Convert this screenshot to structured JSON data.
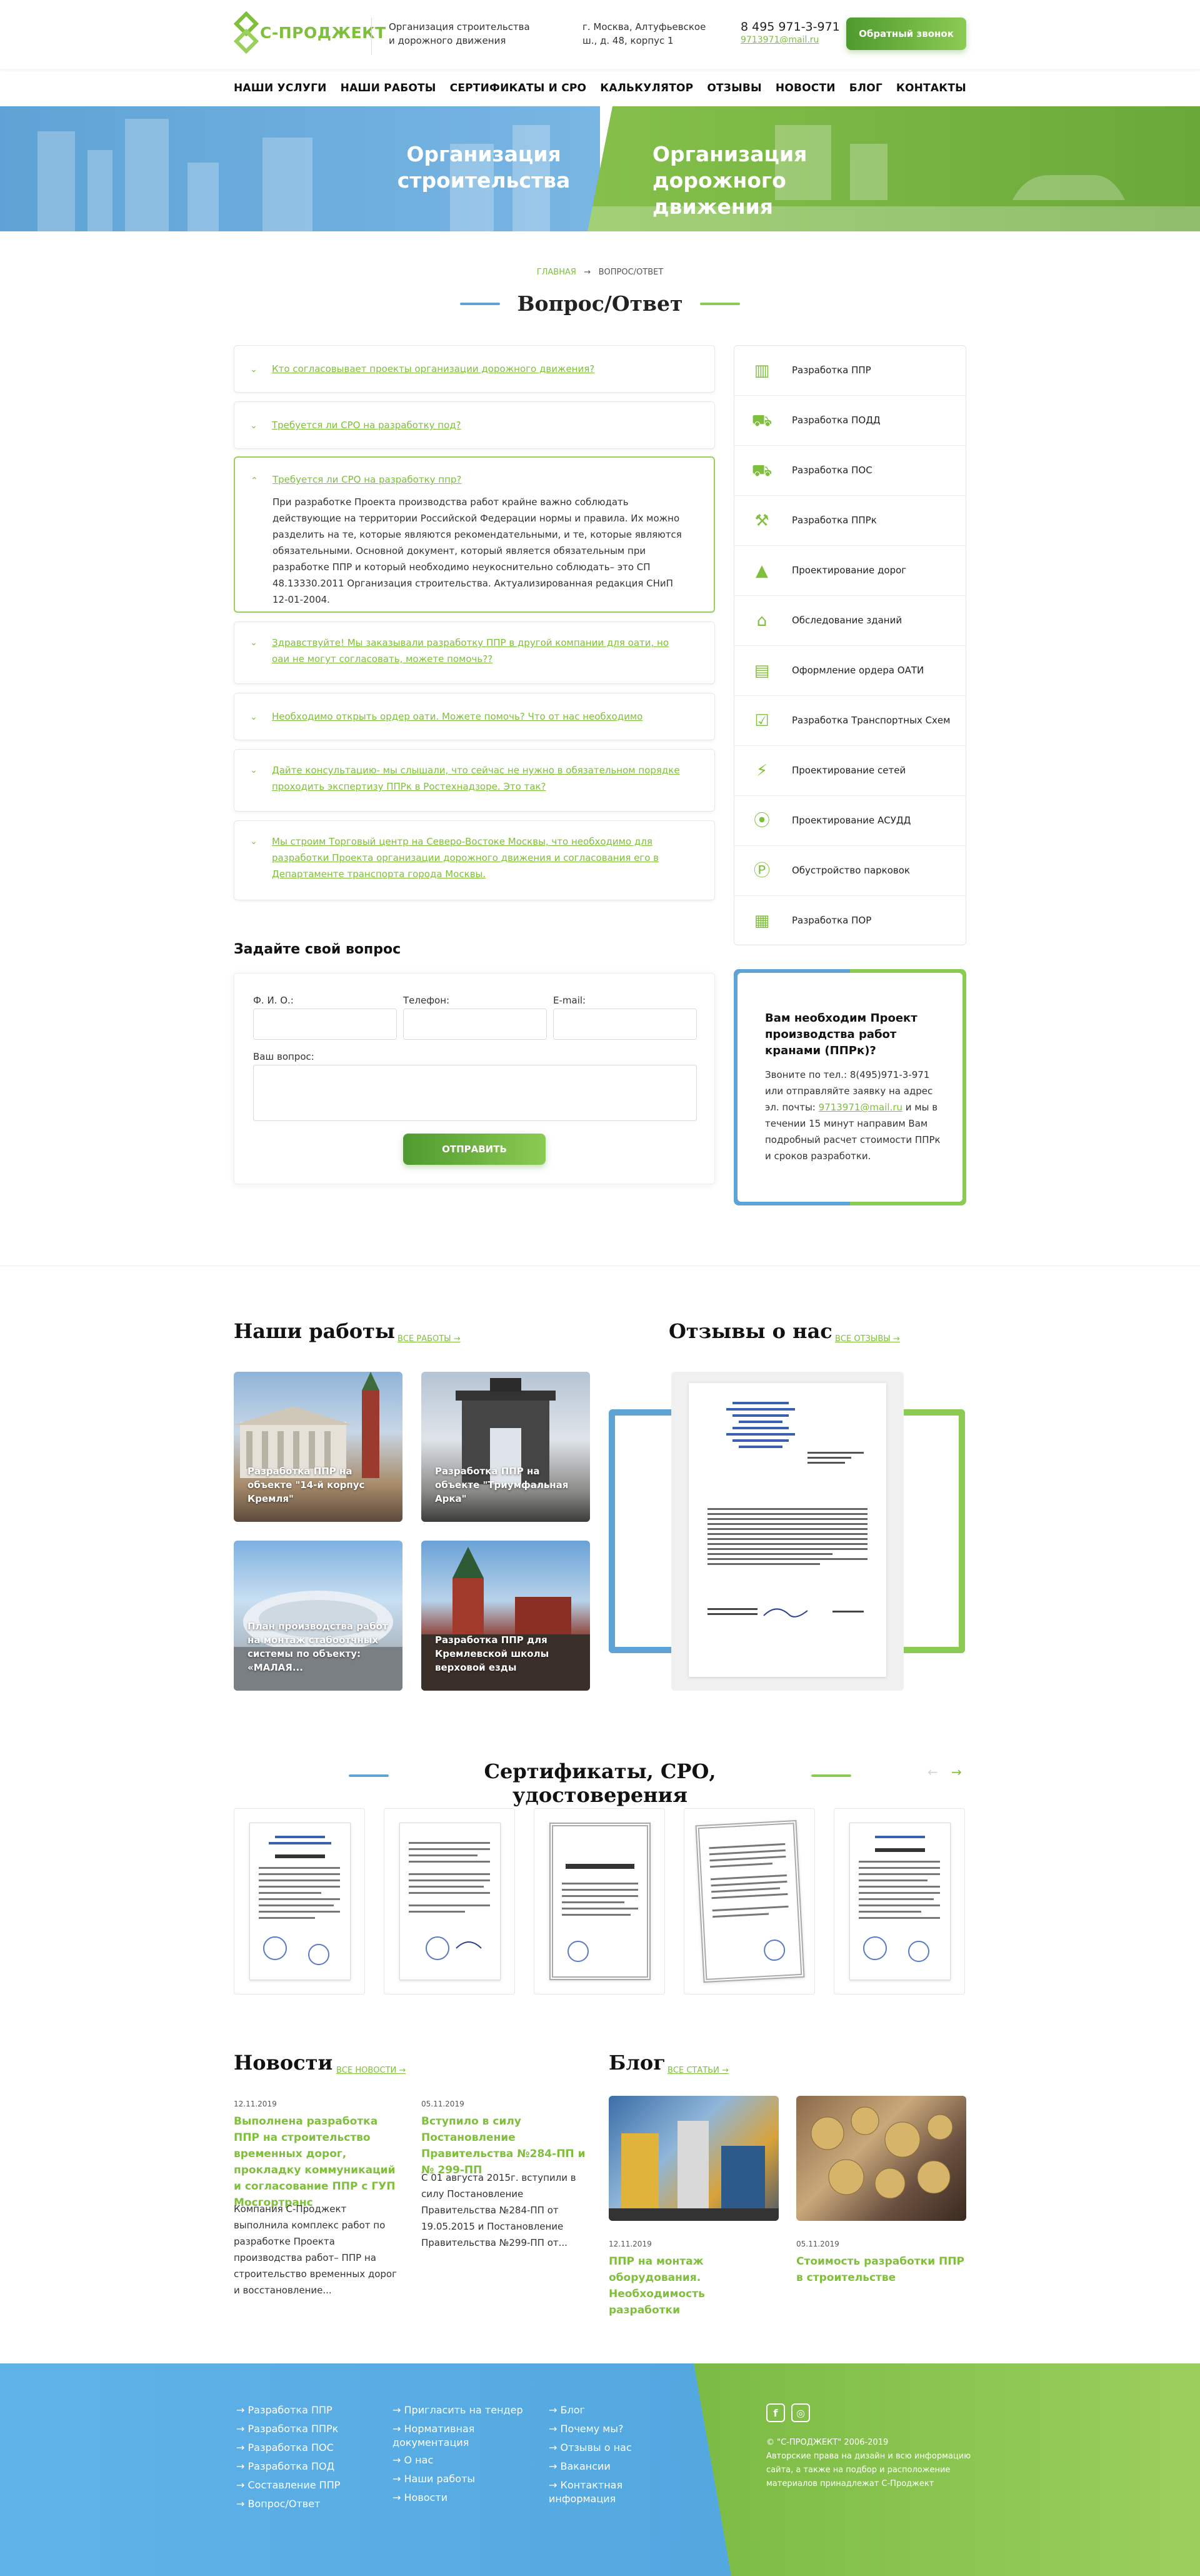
{
  "header": {
    "logo": "С-ПРОДЖЕКТ",
    "tagline": "Организация строительства и дорожного движения",
    "address": "г. Москва, Алтуфьевское ш., д. 48, корпус 1",
    "phone": "8 495 971-3-971",
    "email": "9713971@mail.ru",
    "callback": "Обратный звонок"
  },
  "nav": [
    "НАШИ УСЛУГИ",
    "НАШИ РАБОТЫ",
    "СЕРТИФИКАТЫ И СРО",
    "КАЛЬКУЛЯТОР",
    "ОТЗЫВЫ",
    "НОВОСТИ",
    "БЛОГ",
    "КОНТАКТЫ"
  ],
  "banner": {
    "left": "Организация строительства",
    "right": "Организация дорожного движения"
  },
  "breadcrumb": {
    "home": "ГЛАВНАЯ",
    "current": "ВОПРОС/ОТВЕТ"
  },
  "page_title": "Вопрос/Ответ",
  "faq": [
    {
      "q": "Кто согласовывает проекты организации дорожного движения?"
    },
    {
      "q": "Требуется ли СРО на разработку под?"
    },
    {
      "q": "Требуется ли СРО на разработку ппр?",
      "a": "При разработке Проекта производства работ крайне важно соблюдать действующие на территории Российской Федерации нормы и правила. Их можно разделить на те, которые являются рекомендательными, и те, которые являются обязательными. Основной документ, который является обязательным при разработке ППР и который необходимо неукоснительно соблюдать– это СП 48.13330.2011 Организация строительства. Актуализированная редакция СНиП 12-01-2004."
    },
    {
      "q": "Здравствуйте! Мы заказывали разработку ППР в другой компании для оати, но оаи не могут согласовать, можете помочь??"
    },
    {
      "q": "Необходимо открыть ордер оати. Можете помочь? Что от нас необходимо"
    },
    {
      "q": "Дайте консультацию- мы слышали, что сейчас не нужно в обязательном порядке проходить экспертизу ППРк в Ростехнадзоре. Это так?"
    },
    {
      "q": "Мы строим Торговый центр на Северо-Востоке Москвы, что необходимо для разработки Проекта организации дорожного движения и согласования его в Департаменте транспорта города Москвы."
    }
  ],
  "services": [
    {
      "label": "Разработка ППР",
      "icon": "building-icon"
    },
    {
      "label": "Разработка ПОДД",
      "icon": "road-icon"
    },
    {
      "label": "Разработка ПОС",
      "icon": "truck-icon"
    },
    {
      "label": "Разработка ППРк",
      "icon": "crane-icon"
    },
    {
      "label": "Проектирование дорог",
      "icon": "road-cone-icon"
    },
    {
      "label": "Обследование зданий",
      "icon": "house-icon"
    },
    {
      "label": "Оформление ордера ОАТИ",
      "icon": "document-icon"
    },
    {
      "label": "Разработка Транспортных Схем",
      "icon": "checklist-icon"
    },
    {
      "label": "Проектирование сетей",
      "icon": "power-pole-icon"
    },
    {
      "label": "Проектирование АСУДД",
      "icon": "traffic-light-icon"
    },
    {
      "label": "Обустройство парковок",
      "icon": "parking-icon"
    },
    {
      "label": "Разработка ПОР",
      "icon": "report-icon"
    }
  ],
  "ask": {
    "title": "Задайте свой вопрос",
    "fio": "Ф. И. О.:",
    "phone": "Телефон:",
    "email": "E-mail:",
    "question": "Ваш вопрос:",
    "submit": "ОТПРАВИТЬ"
  },
  "promo": {
    "title": "Вам необходим Проект производства работ кранами (ППРк)?",
    "text1": "Звоните по тел.: 8(495)971-3-971 или отправляйте заявку на адрес эл. почты:",
    "email": "9713971@mail.ru",
    "text2": "и мы в течении 15 минут направим Вам подробный расчет стоимости ППРк и сроков разработки."
  },
  "works": {
    "title": "Наши работы",
    "more": "ВСЕ РАБОТЫ",
    "items": [
      "Разработка ППР на объекте \"14-й корпус Кремля\"",
      "Разработка ППР на объекте \"Триумфальная Арка\"",
      "План производства работ на монтаж стабоотчных системы по объекту: «МАЛАЯ...",
      "Разработка ППР для Кремлевской школы верховой езды"
    ]
  },
  "reviews": {
    "title": "Отзывы о нас",
    "more": "ВСЕ ОТЗЫВЫ"
  },
  "certs": {
    "title": "Сертификаты, СРО, удостоверения"
  },
  "news": {
    "title": "Новости",
    "more": "ВСЕ НОВОСТИ",
    "items": [
      {
        "date": "12.11.2019",
        "title": "Выполнена разработка ППР на строительство временных дорог, прокладку коммуникаций и согласование ППР с ГУП Мосгортранс",
        "text": "Компания С-Проджект выполнила комплекс работ по разработке Проекта производства работ– ППР на строительство временных дорог и восстановление..."
      },
      {
        "date": "05.11.2019",
        "title": "Вступило в силу Постановление Правительства №284-ПП и № 299-ПП",
        "text": "С 01 августа 2015г. вступили в силу Постановление Правительства №284-ПП от 19.05.2015 и Постановление Правительства №299-ПП от..."
      }
    ]
  },
  "blog": {
    "title": "Блог",
    "more": "ВСЕ СТАТЬИ",
    "items": [
      {
        "date": "12.11.2019",
        "title": "ППР на монтаж оборудования. Необходимость разработки"
      },
      {
        "date": "05.11.2019",
        "title": "Стоимость разработки ППР в строительстве"
      }
    ]
  },
  "footer": {
    "col1": [
      "Разработка ППР",
      "Разработка ППРк",
      "Разработка ПОС",
      "Разработка ПОД",
      "Составление ППР",
      "Вопрос/Ответ"
    ],
    "col2": [
      "Пригласить на тендер",
      "Нормативная документация",
      "О нас",
      "Наши работы",
      "Новости"
    ],
    "col3": [
      "Блог",
      "Почему мы?",
      "Отзывы о нас",
      "Вакансии",
      "Контактная информация"
    ],
    "copyright": "© \"С-ПРОДЖЕКТ\" 2006-2019",
    "rights": "Авторские права на дизайн и всю информацию сайта, а также на подбор и расположение материалов принадлежат С-Проджект"
  },
  "colors": {
    "accent": "#7fbf3c",
    "blue": "#5fa3d6"
  }
}
